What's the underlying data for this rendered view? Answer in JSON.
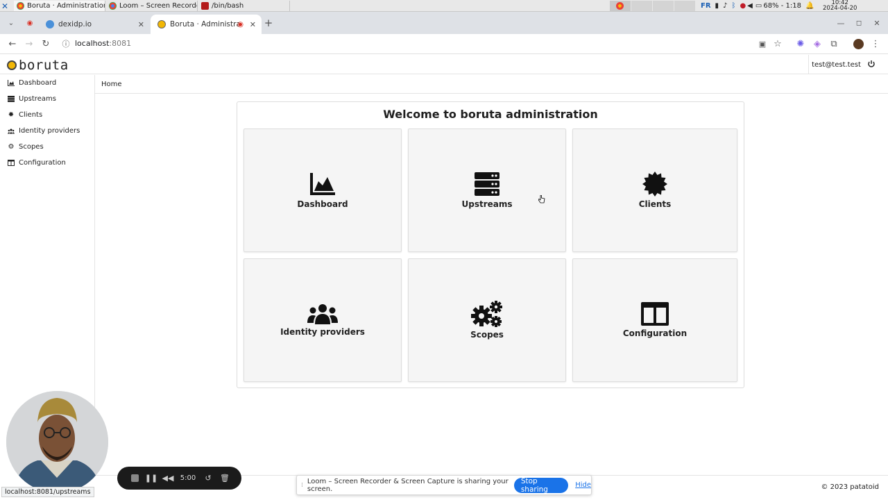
{
  "os_taskbar": {
    "windows": [
      {
        "title": "Boruta · Administration ..."
      },
      {
        "title": "Loom – Screen Recorder..."
      },
      {
        "title": "/bin/bash"
      }
    ],
    "keyboard_layout": "FR",
    "battery": "68% - 1:18",
    "time": "10:42",
    "date": "2024-04-20"
  },
  "browser": {
    "tabs": [
      {
        "title": "dexidp.io"
      },
      {
        "title": "Boruta · Administration"
      }
    ],
    "url_host": "localhost",
    "url_port": ":8081",
    "status_url": "localhost:8081/upstreams"
  },
  "app": {
    "logo_text": "boruta",
    "user_email": "test@test.test",
    "breadcrumb": "Home",
    "welcome_title": "Welcome to boruta administration",
    "sidebar": [
      {
        "label": "Dashboard",
        "icon": "chart-area-icon"
      },
      {
        "label": "Upstreams",
        "icon": "server-icon"
      },
      {
        "label": "Clients",
        "icon": "certificate-icon"
      },
      {
        "label": "Identity providers",
        "icon": "users-icon"
      },
      {
        "label": "Scopes",
        "icon": "cogs-icon"
      },
      {
        "label": "Configuration",
        "icon": "columns-icon"
      }
    ],
    "cards": [
      {
        "label": "Dashboard",
        "icon": "chart-area-icon"
      },
      {
        "label": "Upstreams",
        "icon": "server-icon"
      },
      {
        "label": "Clients",
        "icon": "certificate-icon"
      },
      {
        "label": "Identity providers",
        "icon": "users-icon"
      },
      {
        "label": "Scopes",
        "icon": "cogs-icon"
      },
      {
        "label": "Configuration",
        "icon": "columns-icon"
      }
    ],
    "copyright": "© 2023 patatoid"
  },
  "loom": {
    "share_message": "Loom – Screen Recorder & Screen Capture is sharing your screen.",
    "stop_sharing_label": "Stop sharing",
    "hide_label": "Hide",
    "timer": "5:00"
  },
  "colors": {
    "accent": "#1a73e8",
    "card_bg": "#f5f5f5",
    "logo_sun": "#f2b705"
  }
}
